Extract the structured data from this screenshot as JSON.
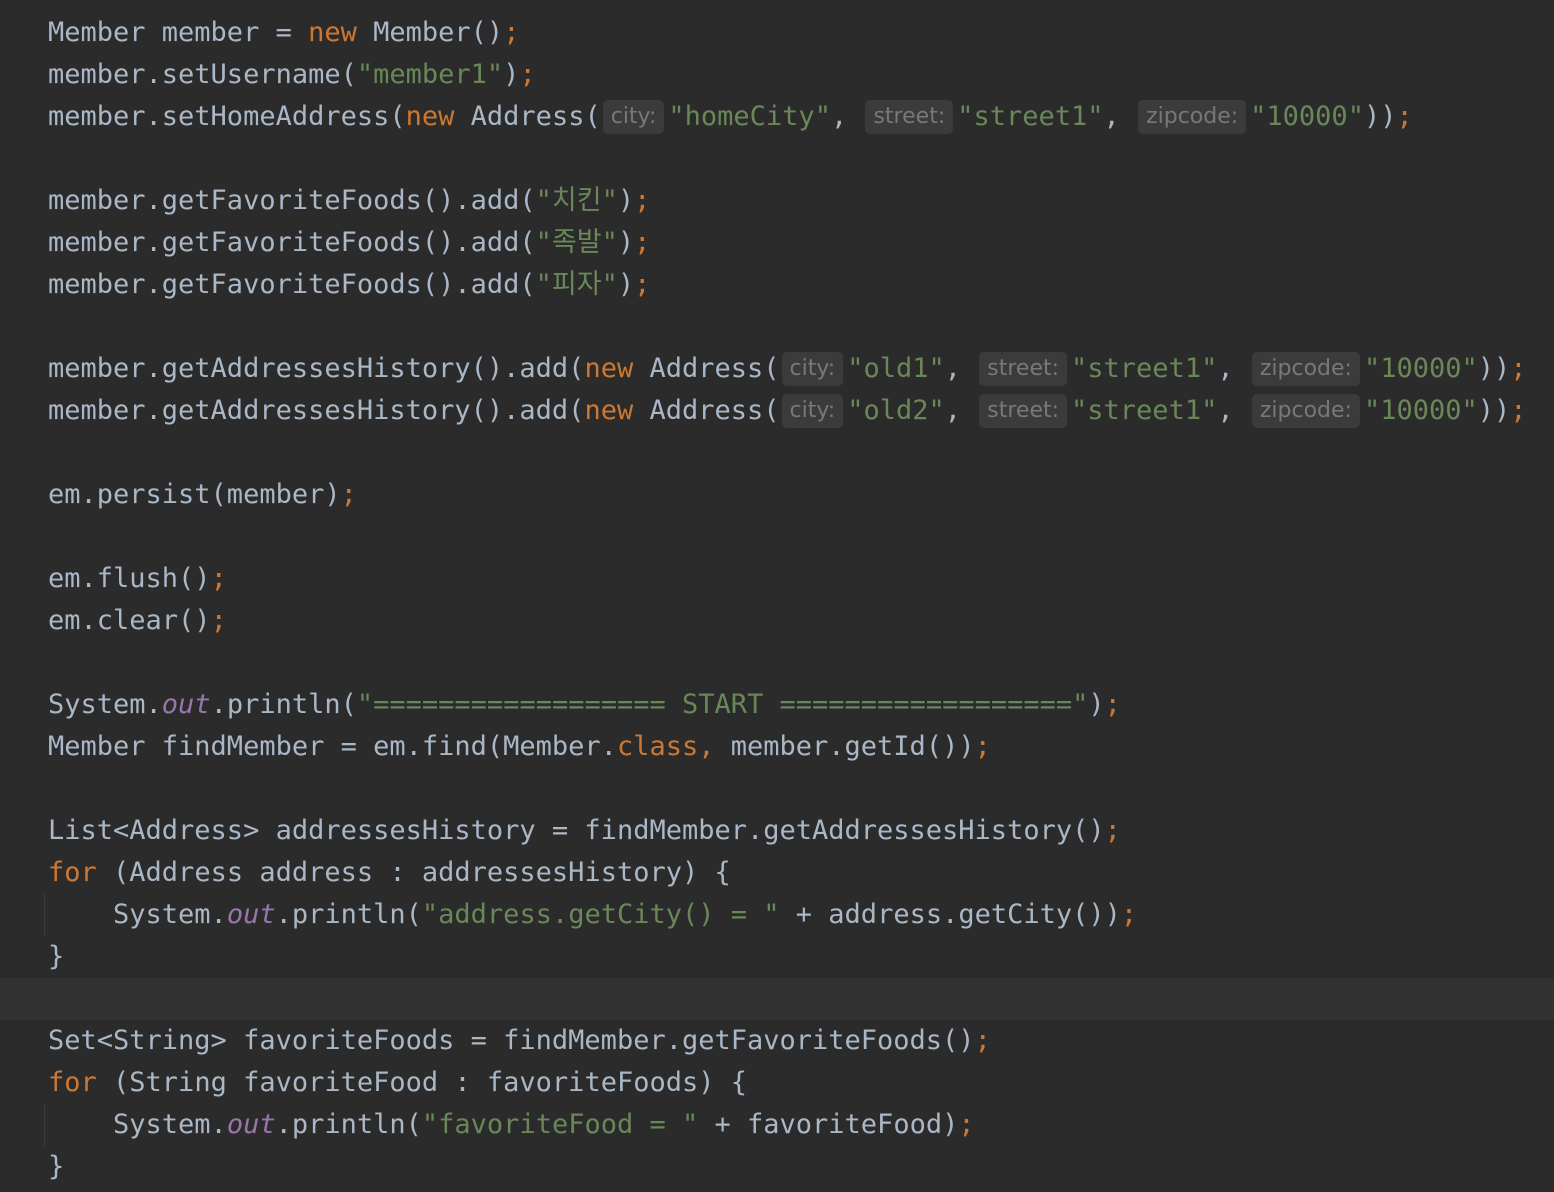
{
  "code": {
    "lines": [
      [
        {
          "t": "Member member = "
        },
        {
          "t": "new",
          "c": "kw"
        },
        {
          "t": " Member()"
        },
        {
          "t": ";",
          "c": "semi"
        }
      ],
      [
        {
          "t": "member.setUsername("
        },
        {
          "t": "\"member1\"",
          "c": "str"
        },
        {
          "t": ")"
        },
        {
          "t": ";",
          "c": "semi"
        }
      ],
      [
        {
          "t": "member.setHomeAddress("
        },
        {
          "t": "new",
          "c": "kw"
        },
        {
          "t": " Address("
        },
        {
          "t": "city:",
          "c": "hint"
        },
        {
          "t": "\"homeCity\"",
          "c": "str"
        },
        {
          "t": ", "
        },
        {
          "t": "street:",
          "c": "hint"
        },
        {
          "t": "\"street1\"",
          "c": "str"
        },
        {
          "t": ", "
        },
        {
          "t": "zipcode:",
          "c": "hint"
        },
        {
          "t": "\"10000\"",
          "c": "str"
        },
        {
          "t": "))"
        },
        {
          "t": ";",
          "c": "semi"
        }
      ],
      [],
      [
        {
          "t": "member.getFavoriteFoods().add("
        },
        {
          "t": "\"치킨\"",
          "c": "str"
        },
        {
          "t": ")"
        },
        {
          "t": ";",
          "c": "semi"
        }
      ],
      [
        {
          "t": "member.getFavoriteFoods().add("
        },
        {
          "t": "\"족발\"",
          "c": "str"
        },
        {
          "t": ")"
        },
        {
          "t": ";",
          "c": "semi"
        }
      ],
      [
        {
          "t": "member.getFavoriteFoods().add("
        },
        {
          "t": "\"피자\"",
          "c": "str"
        },
        {
          "t": ")"
        },
        {
          "t": ";",
          "c": "semi"
        }
      ],
      [],
      [
        {
          "t": "member.getAddressesHistory().add("
        },
        {
          "t": "new",
          "c": "kw"
        },
        {
          "t": " Address("
        },
        {
          "t": "city:",
          "c": "hint"
        },
        {
          "t": "\"old1\"",
          "c": "str"
        },
        {
          "t": ", "
        },
        {
          "t": "street:",
          "c": "hint"
        },
        {
          "t": "\"street1\"",
          "c": "str"
        },
        {
          "t": ", "
        },
        {
          "t": "zipcode:",
          "c": "hint"
        },
        {
          "t": "\"10000\"",
          "c": "str"
        },
        {
          "t": "))"
        },
        {
          "t": ";",
          "c": "semi"
        }
      ],
      [
        {
          "t": "member.getAddressesHistory().add("
        },
        {
          "t": "new",
          "c": "kw"
        },
        {
          "t": " Address("
        },
        {
          "t": "city:",
          "c": "hint"
        },
        {
          "t": "\"old2\"",
          "c": "str"
        },
        {
          "t": ", "
        },
        {
          "t": "street:",
          "c": "hint"
        },
        {
          "t": "\"street1\"",
          "c": "str"
        },
        {
          "t": ", "
        },
        {
          "t": "zipcode:",
          "c": "hint"
        },
        {
          "t": "\"10000\"",
          "c": "str"
        },
        {
          "t": "))"
        },
        {
          "t": ";",
          "c": "semi"
        }
      ],
      [],
      [
        {
          "t": "em.persist(member)"
        },
        {
          "t": ";",
          "c": "semi"
        }
      ],
      [],
      [
        {
          "t": "em.flush()"
        },
        {
          "t": ";",
          "c": "semi"
        }
      ],
      [
        {
          "t": "em.clear()"
        },
        {
          "t": ";",
          "c": "semi"
        }
      ],
      [],
      [
        {
          "t": "System."
        },
        {
          "t": "out",
          "c": "field"
        },
        {
          "t": ".println("
        },
        {
          "t": "\"================== START ==================\"",
          "c": "str"
        },
        {
          "t": ")"
        },
        {
          "t": ";",
          "c": "semi"
        }
      ],
      [
        {
          "t": "Member findMember = em.find(Member."
        },
        {
          "t": "class",
          "c": "kw"
        },
        {
          "t": ", ",
          "c": "semi"
        },
        {
          "t": "member.getId())"
        },
        {
          "t": ";",
          "c": "semi"
        }
      ],
      [],
      [
        {
          "t": "List<Address> addressesHistory = findMember.getAddressesHistory()"
        },
        {
          "t": ";",
          "c": "semi"
        }
      ],
      [
        {
          "t": "for",
          "c": "kw"
        },
        {
          "t": " (Address address : addressesHistory) {"
        }
      ],
      [
        {
          "t": "    System."
        },
        {
          "t": "out",
          "c": "field"
        },
        {
          "t": ".println("
        },
        {
          "t": "\"address.getCity() = \"",
          "c": "str"
        },
        {
          "t": " + address.getCity())"
        },
        {
          "t": ";",
          "c": "semi"
        }
      ],
      [
        {
          "t": "}"
        }
      ],
      [],
      [
        {
          "t": "Set<String> favoriteFoods = findMember.getFavoriteFoods()"
        },
        {
          "t": ";",
          "c": "semi"
        }
      ],
      [
        {
          "t": "for",
          "c": "kw"
        },
        {
          "t": " (String favoriteFood : favoriteFoods) {"
        }
      ],
      [
        {
          "t": "    System."
        },
        {
          "t": "out",
          "c": "field"
        },
        {
          "t": ".println("
        },
        {
          "t": "\"favoriteFood = \"",
          "c": "str"
        },
        {
          "t": " + favoriteFood)"
        },
        {
          "t": ";",
          "c": "semi"
        }
      ],
      [
        {
          "t": "}"
        }
      ]
    ],
    "caret_line": 23
  },
  "colors": {
    "background": "#2b2b2b",
    "text": "#a9b7c6",
    "keyword": "#cc7832",
    "string": "#6a8759",
    "static_field": "#9876aa",
    "caret_row": "#323232",
    "hint_bg": "#3b3b3b",
    "hint_text": "#787878"
  }
}
